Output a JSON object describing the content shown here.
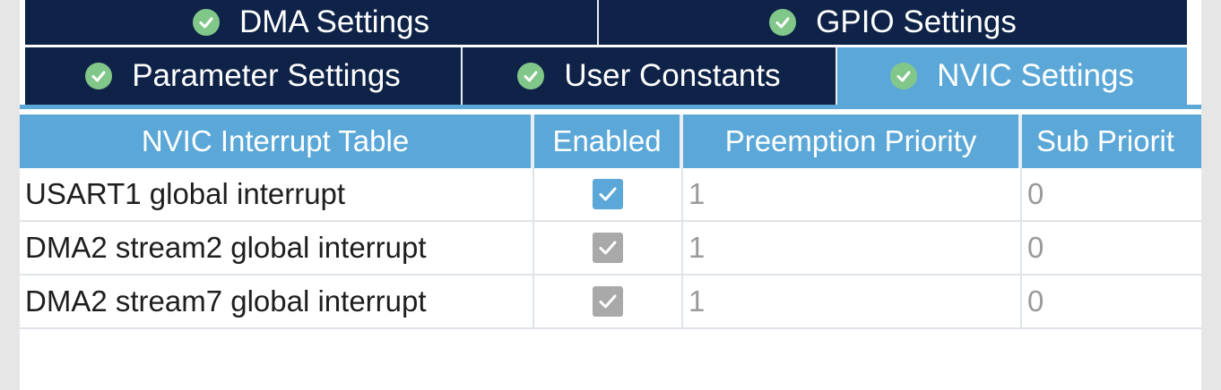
{
  "tabs_top": [
    {
      "label": "DMA Settings"
    },
    {
      "label": "GPIO Settings"
    }
  ],
  "tabs_bottom": [
    {
      "label": "Parameter Settings",
      "active": false
    },
    {
      "label": "User Constants",
      "active": false
    },
    {
      "label": "NVIC Settings",
      "active": true
    }
  ],
  "table": {
    "headers": [
      "NVIC Interrupt Table",
      "Enabled",
      "Preemption Priority",
      "Sub Priorit"
    ],
    "rows": [
      {
        "name": "USART1 global interrupt",
        "enabled": true,
        "editable": true,
        "preemption": "1",
        "sub": "0"
      },
      {
        "name": "DMA2 stream2 global interrupt",
        "enabled": true,
        "editable": false,
        "preemption": "1",
        "sub": "0"
      },
      {
        "name": "DMA2 stream7 global interrupt",
        "enabled": true,
        "editable": false,
        "preemption": "1",
        "sub": "0"
      }
    ]
  },
  "colors": {
    "tab_dark": "#0f2349",
    "accent_blue": "#5ba8d8",
    "check_green": "#82c78a",
    "checkbox_disabled": "#a9a9a9"
  }
}
